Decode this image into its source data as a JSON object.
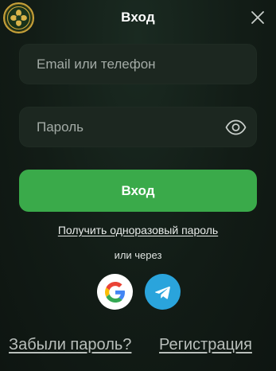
{
  "dialog": {
    "title": "Вход",
    "close_icon": "close-icon"
  },
  "login_field": {
    "placeholder": "Email или телефон",
    "value": ""
  },
  "password_field": {
    "placeholder": "Пароль",
    "value": "",
    "toggle_icon": "eye-icon"
  },
  "actions": {
    "submit_label": "Вход",
    "otp_link": "Получить одноразовый пароль",
    "or_text": "или через"
  },
  "social": {
    "google_icon": "google-icon",
    "telegram_icon": "telegram-icon"
  },
  "footer": {
    "forgot_password": "Забыли пароль?",
    "register": "Регистрация"
  },
  "colors": {
    "primary_button": "#3aaa4a",
    "background": "#121c16",
    "field_background": "#1c2720",
    "telegram": "#2aa4dc",
    "logo_ring": "#c7a23a"
  }
}
